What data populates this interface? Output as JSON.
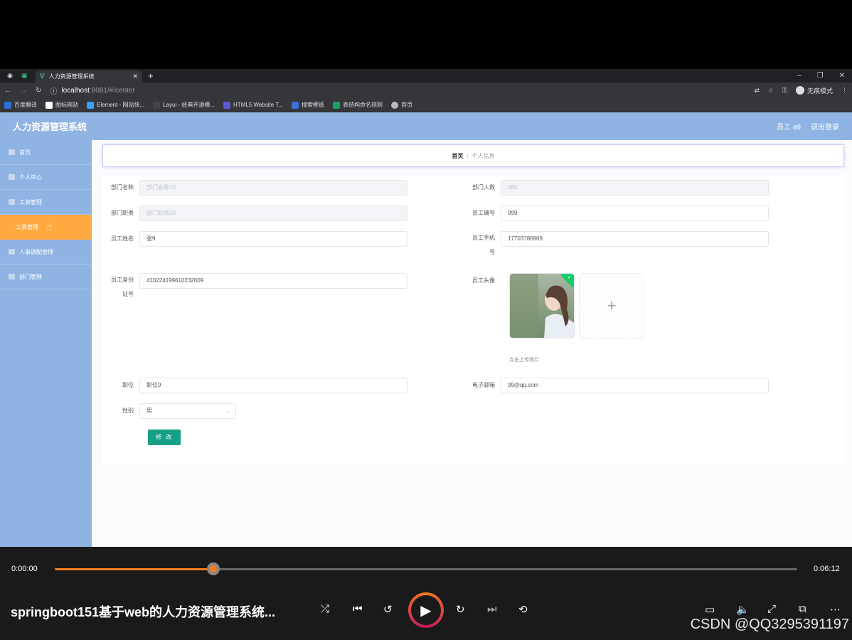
{
  "browser": {
    "tab_title": "人力资源管理系统",
    "url_host": "localhost",
    "url_path": ":8081/#/center",
    "profile_label": "无痕模式",
    "bookmarks": [
      "百度翻译",
      "图标网站",
      "Element - 网站快...",
      "Layui - 经典开源模...",
      "HTML5 Website T...",
      "搜索壁纸",
      "表结构命名规则",
      "首页"
    ]
  },
  "app": {
    "title": "人力资源管理系统",
    "user": "员工 a9",
    "logout": "退出登录"
  },
  "sidebar": {
    "items": [
      {
        "label": "首页"
      },
      {
        "label": "个人中心"
      },
      {
        "label": "工资管理"
      },
      {
        "label": "工资管理"
      },
      {
        "label": "人事调配管理"
      },
      {
        "label": "部门管理"
      }
    ]
  },
  "breadcrumb": {
    "home": "首页",
    "separator": "/",
    "current": "个人信息"
  },
  "form": {
    "dept_name": {
      "label": "部门名称",
      "value": "部门名称10"
    },
    "dept_count": {
      "label": "部门人数",
      "value": "380"
    },
    "dept_duty": {
      "label": "部门职责",
      "value": "部门职责10"
    },
    "emp_no": {
      "label": "员工编号",
      "value": "999"
    },
    "emp_name": {
      "label": "员工姓名",
      "value": "张9"
    },
    "emp_phone": {
      "label_line1": "员工手机",
      "label_line2": "号",
      "value": "17703786969"
    },
    "emp_id": {
      "label_line1": "员工身份",
      "label_line2": "证号",
      "value": "410224199610232009"
    },
    "emp_avatar": {
      "label": "员工头像",
      "tip": "点击上传照片",
      "add_symbol": "+"
    },
    "position": {
      "label": "职位",
      "value": "职位9"
    },
    "email": {
      "label": "电子邮箱",
      "value": "99@qq.com"
    },
    "gender": {
      "label": "性别",
      "value": "男"
    },
    "submit": "修 改"
  },
  "player": {
    "current_time": "0:00:00",
    "duration": "0:06:12",
    "progress": 0.214,
    "title": "springboot151基于web的人力资源管理系统...",
    "watermark": "CSDN @QQ3295391197"
  },
  "colors": {
    "header": "#8fb4e3",
    "active_menu": "#ffa940",
    "submit": "#16a085",
    "progress": "#f47b20"
  }
}
